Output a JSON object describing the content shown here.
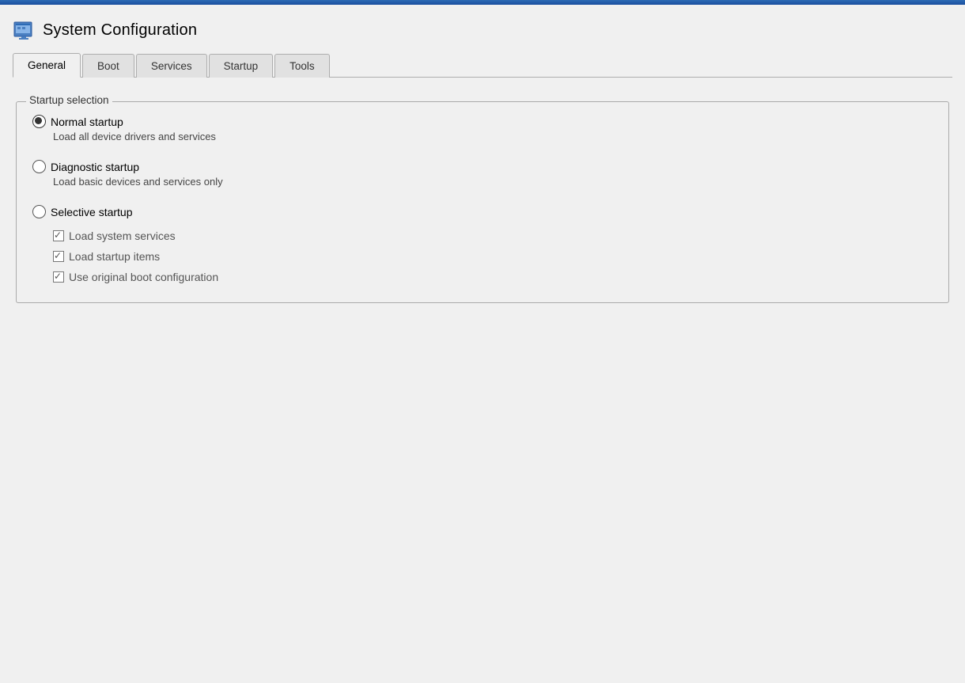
{
  "titleBar": {
    "title": "System Configuration",
    "iconAlt": "system-config-icon"
  },
  "tabs": [
    {
      "id": "general",
      "label": "General",
      "active": true
    },
    {
      "id": "boot",
      "label": "Boot",
      "active": false
    },
    {
      "id": "services",
      "label": "Services",
      "active": false
    },
    {
      "id": "startup",
      "label": "Startup",
      "active": false
    },
    {
      "id": "tools",
      "label": "Tools",
      "active": false
    }
  ],
  "content": {
    "groupBox": {
      "legend": "Startup selection",
      "options": [
        {
          "id": "normal-startup",
          "label": "Normal startup",
          "description": "Load all device drivers and services",
          "checked": true
        },
        {
          "id": "diagnostic-startup",
          "label": "Diagnostic startup",
          "description": "Load basic devices and services only",
          "checked": false
        },
        {
          "id": "selective-startup",
          "label": "Selective startup",
          "description": null,
          "checked": false
        }
      ],
      "selectiveOptions": [
        {
          "id": "load-system-services",
          "label": "Load system services",
          "checked": true
        },
        {
          "id": "load-startup-items",
          "label": "Load startup items",
          "checked": true
        },
        {
          "id": "use-original-boot",
          "label": "Use original boot configuration",
          "checked": true
        }
      ]
    }
  }
}
